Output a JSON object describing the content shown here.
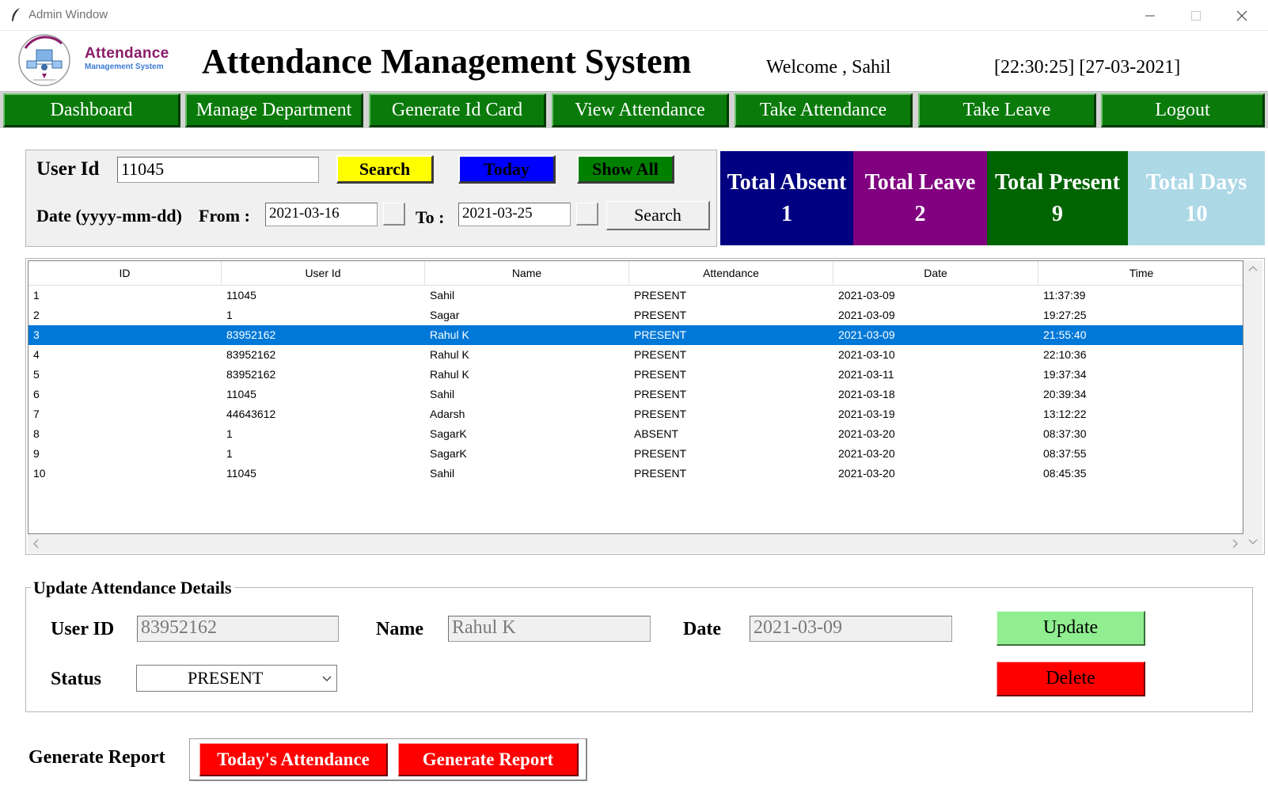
{
  "window": {
    "title": "Admin Window"
  },
  "header": {
    "logo_line1": "Attendance",
    "logo_line2": "Management System",
    "title": "Attendance Management System",
    "welcome": "Welcome , Sahil",
    "datetime": "[22:30:25] [27-03-2021]"
  },
  "nav": {
    "dashboard": "Dashboard",
    "manage_department": "Manage Department",
    "generate_id_card": "Generate Id Card",
    "view_attendance": "View Attendance",
    "take_attendance": "Take Attendance",
    "take_leave": "Take Leave",
    "logout": "Logout"
  },
  "search": {
    "user_id_label": "User Id",
    "user_id_value": "11045",
    "search_button": "Search",
    "today_button": "Today",
    "show_all_button": "Show All",
    "date_label": "Date (yyyy-mm-dd)",
    "from_label": "From :",
    "from_value": "2021-03-16",
    "to_label": "To :",
    "to_value": "2021-03-25",
    "date_search_button": "Search"
  },
  "stats": {
    "absent": {
      "label": "Total Absent",
      "value": "1",
      "color": "#000080"
    },
    "leave": {
      "label": "Total Leave",
      "value": "2",
      "color": "#800080"
    },
    "present": {
      "label": "Total Present",
      "value": "9",
      "color": "#006400"
    },
    "days": {
      "label": "Total Days",
      "value": "10",
      "color": "#add8e6"
    }
  },
  "table": {
    "columns": [
      "ID",
      "User Id",
      "Name",
      "Attendance",
      "Date",
      "Time"
    ],
    "selected_row": 2,
    "rows": [
      [
        "1",
        "11045",
        "Sahil",
        "PRESENT",
        "2021-03-09",
        "11:37:39"
      ],
      [
        "2",
        "1",
        "Sagar",
        "PRESENT",
        "2021-03-09",
        "19:27:25"
      ],
      [
        "3",
        "83952162",
        "Rahul K",
        "PRESENT",
        "2021-03-09",
        "21:55:40"
      ],
      [
        "4",
        "83952162",
        "Rahul K",
        "PRESENT",
        "2021-03-10",
        "22:10:36"
      ],
      [
        "5",
        "83952162",
        "Rahul K",
        "PRESENT",
        "2021-03-11",
        "19:37:34"
      ],
      [
        "6",
        "11045",
        "Sahil",
        "PRESENT",
        "2021-03-18",
        "20:39:34"
      ],
      [
        "7",
        "44643612",
        "Adarsh",
        "PRESENT",
        "2021-03-19",
        "13:12:22"
      ],
      [
        "8",
        "1",
        "SagarK",
        "ABSENT",
        "2021-03-20",
        "08:37:30"
      ],
      [
        "9",
        "1",
        "SagarK",
        "PRESENT",
        "2021-03-20",
        "08:37:55"
      ],
      [
        "10",
        "11045",
        "Sahil",
        "PRESENT",
        "2021-03-20",
        "08:45:35"
      ]
    ]
  },
  "update": {
    "title": "Update Attendance Details",
    "user_id_label": "User ID",
    "user_id_value": "83952162",
    "name_label": "Name",
    "name_value": "Rahul K",
    "date_label": "Date",
    "date_value": "2021-03-09",
    "status_label": "Status",
    "status_value": "PRESENT",
    "update_button": "Update",
    "delete_button": "Delete"
  },
  "report": {
    "label": "Generate Report",
    "todays_button": "Today's Attendance",
    "generate_button": "Generate Report"
  },
  "colors": {
    "nav_green": "#0a7a0a",
    "search_yellow": "#ffff00",
    "today_blue": "#0000ff",
    "show_all_green": "#008000",
    "update_green": "#90ee90",
    "delete_red": "#ff0000",
    "selection_blue": "#0078d7"
  }
}
